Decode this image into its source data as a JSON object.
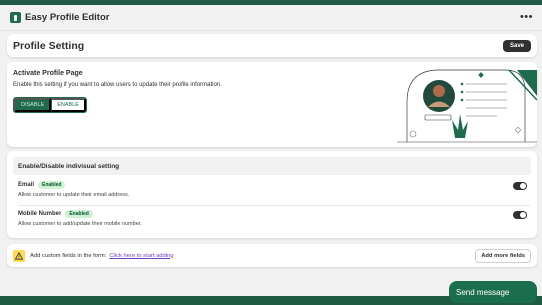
{
  "app": {
    "title": "Easy Profile Editor",
    "menu_icon": "ellipsis-icon"
  },
  "header": {
    "title": "Profile Setting",
    "save_label": "Save"
  },
  "activate": {
    "title": "Activate Profile Page",
    "description": "Enable this setting if you want to allow users to update their profile information.",
    "disable_label": "DISABLE",
    "enable_label": "ENABLE",
    "selected": "DISABLE"
  },
  "fields": {
    "heading": "Enable/Disable indivisual setting",
    "items": [
      {
        "label": "Email",
        "badge": "Enabled",
        "description": "Allow customer to update their email address.",
        "on": true
      },
      {
        "label": "Mobile Number",
        "badge": "Enabled",
        "description": "Allow customer to add/update their mobile number.",
        "on": true
      }
    ]
  },
  "custom": {
    "text": "Add custom fields in the form:",
    "link": "Click here to start adding",
    "button": "Add more fields"
  },
  "chat": {
    "label": "Send message"
  },
  "colors": {
    "brand": "#1f6b4e",
    "badge_bg": "#cdf2d3",
    "link": "#6e43c5",
    "warning": "#ffd952"
  }
}
